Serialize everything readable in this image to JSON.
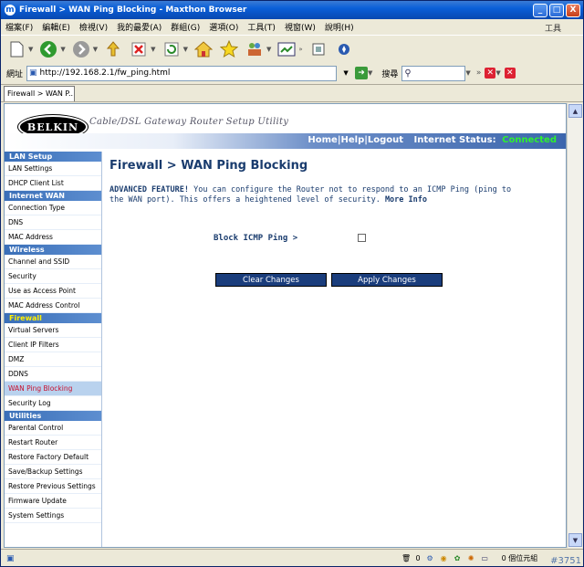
{
  "window": {
    "title": "Firewall > WAN Ping Blocking - Maxthon Browser",
    "app_icon": "m",
    "controls": [
      "_",
      "□",
      "X"
    ]
  },
  "menu": {
    "items": [
      "檔案(F)",
      "編輯(E)",
      "檢視(V)",
      "我的最愛(A)",
      "群組(G)",
      "選項(O)",
      "工具(T)",
      "視窗(W)",
      "說明(H)"
    ],
    "tools_label": "工具"
  },
  "address": {
    "label": "網址",
    "url": "http://192.168.2.1/fw_ping.html",
    "search_label": "搜尋",
    "search_icon": "search-icon"
  },
  "tabs": [
    {
      "label": "Firewall > WAN P..."
    }
  ],
  "page": {
    "brand": "BELKIN",
    "subtitle": "Cable/DSL Gateway Router Setup Utility",
    "nav": {
      "home": "Home",
      "help": "Help",
      "logout": "Logout",
      "sep": "|",
      "status_label": "Internet Status:",
      "status_value": "Connected"
    },
    "title": "Firewall > WAN Ping Blocking",
    "advanced": "ADVANCED FEATURE!",
    "description": " You can configure the Router not to respond to an ICMP Ping (ping to the WAN port). This offers a heightened level of security.",
    "more_info": "More Info",
    "option_label": "Block ICMP Ping >",
    "option_checked": false,
    "clear_label": "Clear Changes",
    "apply_label": "Apply Changes"
  },
  "sidebar": {
    "sections": [
      {
        "title": "LAN Setup",
        "items": [
          "LAN Settings",
          "DHCP Client List"
        ]
      },
      {
        "title": "Internet WAN",
        "items": [
          "Connection Type",
          "DNS",
          "MAC Address"
        ]
      },
      {
        "title": "Wireless",
        "items": [
          "Channel and SSID",
          "Security",
          "Use as Access Point",
          "MAC Address Control"
        ]
      },
      {
        "title": "Firewall",
        "items": [
          "Virtual Servers",
          "Client IP Filters",
          "DMZ",
          "DDNS",
          "WAN Ping Blocking",
          "Security Log"
        ]
      },
      {
        "title": "Utilities",
        "items": [
          "Parental Control",
          "Restart Router",
          "Restore Factory Default",
          "Save/Backup Settings",
          "Restore Previous Settings",
          "Firmware Update",
          "System Settings"
        ]
      }
    ]
  },
  "statusbar": {
    "count": "0",
    "text": "0 個位元組",
    "mark": "#3751"
  }
}
